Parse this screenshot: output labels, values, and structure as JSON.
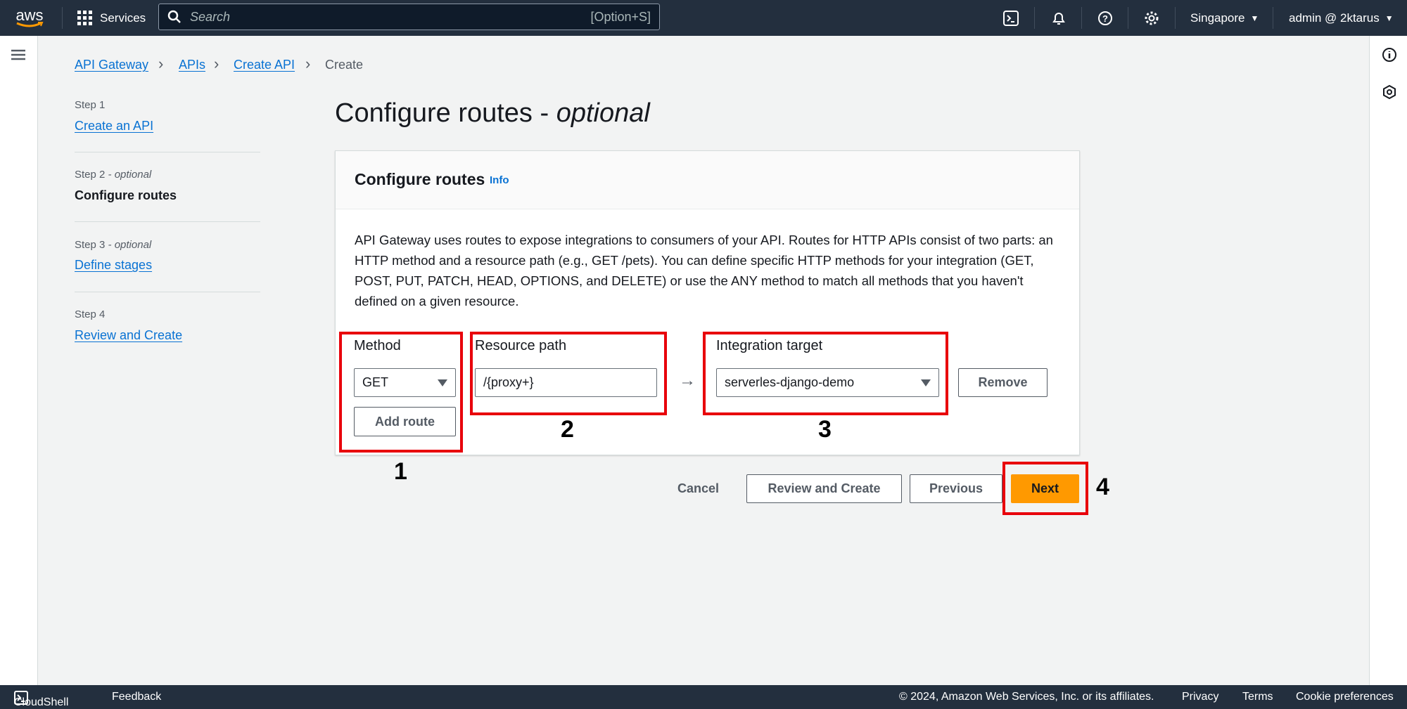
{
  "topbar": {
    "logo": "aws",
    "services": "Services",
    "search_placeholder": "Search",
    "search_shortcut": "[Option+S]",
    "region": "Singapore",
    "account": "admin @ 2ktarus"
  },
  "breadcrumb": [
    "API Gateway",
    "APIs",
    "Create API",
    "Create"
  ],
  "steps": [
    {
      "label": "Step 1",
      "label_suffix": "",
      "title": "Create an API"
    },
    {
      "label": "Step 2",
      "label_suffix": " - optional",
      "title": "Configure routes"
    },
    {
      "label": "Step 3",
      "label_suffix": " - optional",
      "title": "Define stages"
    },
    {
      "label": "Step 4",
      "label_suffix": "",
      "title": "Review and Create"
    }
  ],
  "page_title": "Configure routes - ",
  "page_title_suffix": "optional",
  "panel": {
    "title": "Configure routes",
    "info": "Info",
    "description": "API Gateway uses routes to expose integrations to consumers of your API. Routes for HTTP APIs consist of two parts: an HTTP method and a resource path (e.g., GET /pets). You can define specific HTTP methods for your integration (GET, POST, PUT, PATCH, HEAD, OPTIONS, and DELETE) or use the ANY method to match all methods that you haven't defined on a given resource.",
    "method_label": "Method",
    "method_value": "GET",
    "add_route": "Add route",
    "path_label": "Resource path",
    "path_value": "/{proxy+}",
    "arrow": "→",
    "target_label": "Integration target",
    "target_value": "serverles-django-demo",
    "remove": "Remove"
  },
  "annotations": [
    "1",
    "2",
    "3",
    "4"
  ],
  "actions": {
    "cancel": "Cancel",
    "review": "Review and Create",
    "previous": "Previous",
    "next": "Next"
  },
  "footer": {
    "cloudshell": "CloudShell",
    "feedback": "Feedback",
    "copyright": "© 2024, Amazon Web Services, Inc. or its affiliates.",
    "privacy": "Privacy",
    "terms": "Terms",
    "cookies": "Cookie preferences"
  },
  "colors": {
    "accent": "#ff9900",
    "link": "#0972d3",
    "annotation": "#e8000b",
    "nav": "#232f3e"
  }
}
